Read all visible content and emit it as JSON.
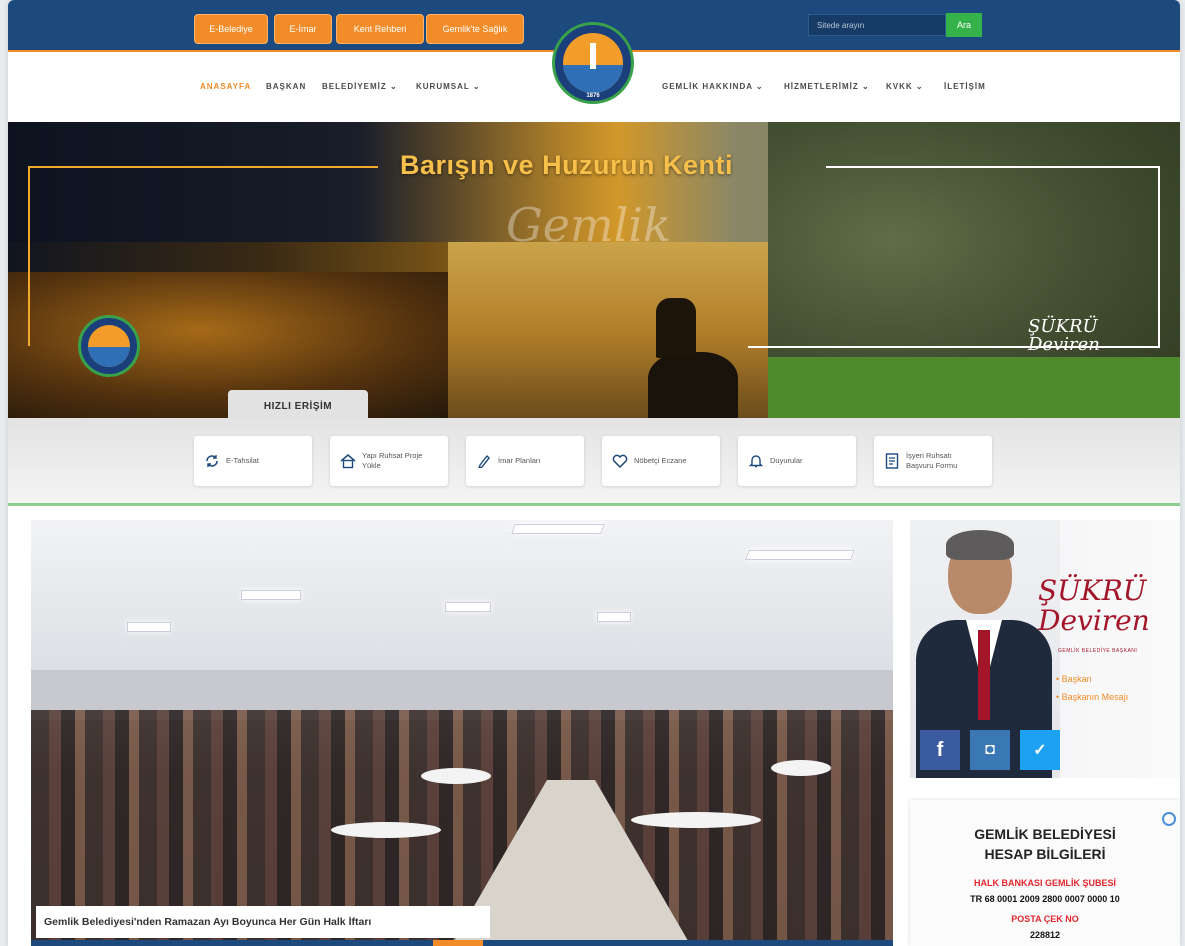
{
  "topbar": {
    "quick_links": [
      "E-Belediye",
      "E-İmar",
      "Kent Rehberi",
      "Gemlik'te Sağlık"
    ],
    "search_placeholder": "Sitede arayın",
    "search_button": "Ara"
  },
  "logo": {
    "year": "1876"
  },
  "nav": {
    "left": [
      "ANASAYFA",
      "BAŞKAN",
      "BELEDİYEMİZ ⌄",
      "KURUMSAL ⌄"
    ],
    "right": [
      "GEMLİK HAKKINDA ⌄",
      "HİZMETLERİMİZ ⌄",
      "KVKK ⌄",
      "İLETİŞİM"
    ]
  },
  "hero": {
    "title": "Barışın ve Huzurun Kenti",
    "script": "Gemlik",
    "signature_line1": "ŞÜKRÜ",
    "signature_line2": "Deviren",
    "tab": "HIZLI ERİŞİM"
  },
  "quick_access": [
    {
      "label": "E-Tahsilat",
      "icon": "refresh-icon"
    },
    {
      "label": "Yapı Ruhsat Proje Yükle",
      "icon": "house-icon"
    },
    {
      "label": "İmar Planları",
      "icon": "pencil-icon"
    },
    {
      "label": "Nöbetçi Eczane",
      "icon": "heart-icon"
    },
    {
      "label": "Duyurular",
      "icon": "bell-icon"
    },
    {
      "label": "İşyeri Ruhsatı Başvuru Formu",
      "icon": "document-icon"
    }
  ],
  "news": {
    "caption": "Gemlik Belediyesi'nden Ramazan Ayı Boyunca Her Gün Halk İftarı"
  },
  "mayor": {
    "signature_line1": "ŞÜKRÜ",
    "signature_line2": "Deviren",
    "subtitle": "GEMLİK BELEDİYE BAŞKANI",
    "links": [
      "Başkan",
      "Başkanın Mesajı"
    ],
    "social": [
      "f",
      "◘",
      "✓"
    ]
  },
  "bank": {
    "title_line1": "GEMLİK BELEDİYESİ",
    "title_line2": "HESAP BİLGİLERİ",
    "bank_name": "HALK BANKASI GEMLİK ŞUBESİ",
    "iban": "TR 68 0001 2009 2800 0007 0000 10",
    "postcheck_label": "POSTA ÇEK NO",
    "postcheck_no": "228812"
  },
  "colors": {
    "primary": "#1c4a7e",
    "accent": "#f28c28",
    "green": "#35b34a",
    "red": "#e0262d"
  }
}
